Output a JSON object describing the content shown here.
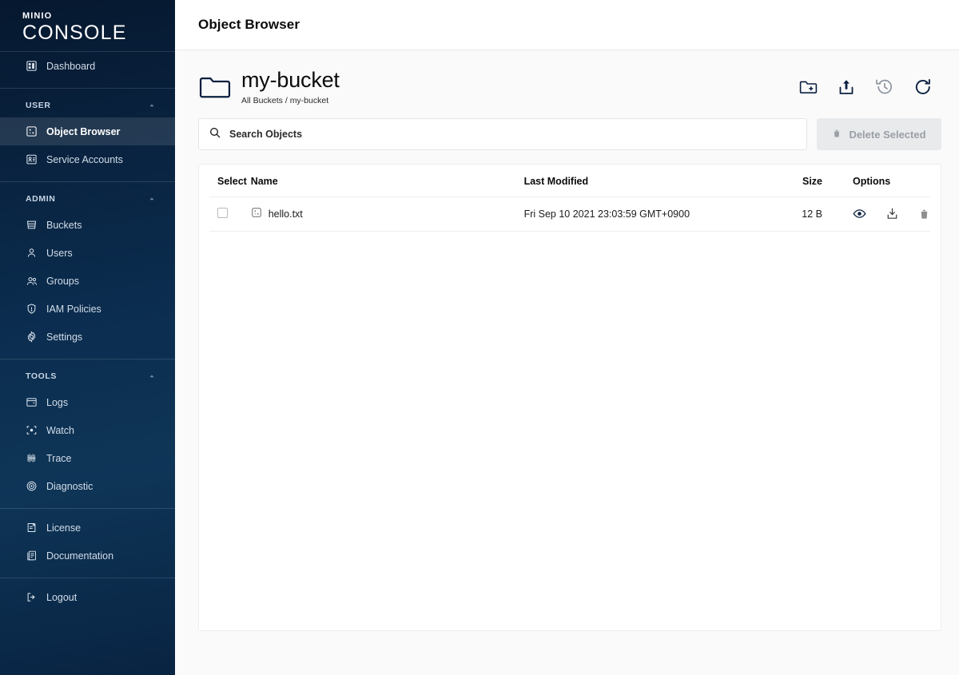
{
  "brand": {
    "top": "MINIO",
    "bottom": "CONSOLE"
  },
  "sidebar": {
    "dashboard": {
      "label": "Dashboard",
      "icon": "dashboard-icon"
    },
    "sections": [
      {
        "title": "USER",
        "items": [
          {
            "label": "Object Browser",
            "icon": "object-browser-icon",
            "active": true
          },
          {
            "label": "Service Accounts",
            "icon": "service-accounts-icon",
            "active": false
          }
        ]
      },
      {
        "title": "ADMIN",
        "items": [
          {
            "label": "Buckets",
            "icon": "bucket-icon",
            "active": false
          },
          {
            "label": "Users",
            "icon": "user-icon",
            "active": false
          },
          {
            "label": "Groups",
            "icon": "groups-icon",
            "active": false
          },
          {
            "label": "IAM Policies",
            "icon": "shield-icon",
            "active": false
          },
          {
            "label": "Settings",
            "icon": "gear-icon",
            "active": false
          }
        ]
      },
      {
        "title": "TOOLS",
        "items": [
          {
            "label": "Logs",
            "icon": "logs-icon",
            "active": false
          },
          {
            "label": "Watch",
            "icon": "watch-icon",
            "active": false
          },
          {
            "label": "Trace",
            "icon": "trace-icon",
            "active": false
          },
          {
            "label": "Diagnostic",
            "icon": "diagnostic-icon",
            "active": false
          }
        ]
      }
    ],
    "footer_items": [
      {
        "label": "License",
        "icon": "license-icon"
      },
      {
        "label": "Documentation",
        "icon": "documentation-icon"
      }
    ],
    "logout": {
      "label": "Logout",
      "icon": "logout-icon"
    }
  },
  "header": {
    "title": "Object Browser"
  },
  "bucket": {
    "name": "my-bucket",
    "breadcrumb": "All Buckets / my-bucket",
    "actions": [
      {
        "name": "create-folder-icon",
        "tooltip": "Create new path"
      },
      {
        "name": "upload-icon",
        "tooltip": "Upload"
      },
      {
        "name": "history-icon",
        "tooltip": "Rewind"
      },
      {
        "name": "refresh-icon",
        "tooltip": "Refresh"
      }
    ]
  },
  "search": {
    "placeholder": "Search Objects",
    "value": ""
  },
  "delete_button": {
    "label": "Delete Selected",
    "icon": "trash-icon",
    "disabled": true
  },
  "table": {
    "columns": [
      "Select",
      "Name",
      "Last Modified",
      "Size",
      "Options"
    ],
    "rows": [
      {
        "selected": false,
        "name": "hello.txt",
        "file_icon": "file-text-icon",
        "last_modified": "Fri Sep 10 2021 23:03:59 GMT+0900",
        "size": "12 B",
        "options": [
          "preview-icon",
          "download-icon",
          "delete-icon"
        ]
      }
    ]
  },
  "colors": {
    "sidebar_top": "#06182f",
    "sidebar_mid": "#0e3557",
    "accent": "#0b2c4e",
    "page_bg": "#fafafa",
    "text_dark": "#0b0b0b",
    "disabled_bg": "#e8eaec",
    "disabled_text": "#9a9fa5"
  }
}
